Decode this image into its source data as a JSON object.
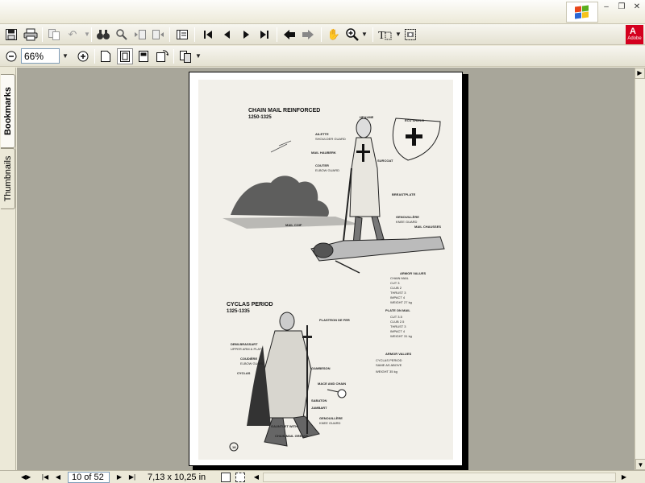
{
  "window": {
    "min_glyph": "–",
    "restore_glyph": "❐",
    "close_glyph": "✕"
  },
  "toolbar": {
    "brand": "Adobe",
    "icons": [
      "save-icon",
      "print-icon",
      "copy-icon",
      "undo-icon",
      "find-icon",
      "search-icon",
      "previous-view-icon",
      "next-view-icon",
      "document-properties-icon",
      "first-page-icon",
      "previous-page-icon",
      "next-page-icon",
      "last-page-icon",
      "go-back-icon",
      "go-forward-icon",
      "hand-tool-icon",
      "zoom-in-icon",
      "text-select-icon",
      "snapshot-icon"
    ]
  },
  "zoombar": {
    "zoom_value": "66%",
    "icons": [
      "zoom-out-icon",
      "zoom-in-circle-icon",
      "actual-size-icon",
      "fit-page-icon",
      "fit-width-icon",
      "rotate-view-icon",
      "page-layout-icon"
    ]
  },
  "side_tabs": {
    "bookmarks": "Bookmarks",
    "thumbnails": "Thumbnails"
  },
  "document": {
    "section1_title": "CHAIN MAIL REINFORCED",
    "section1_years": "1250-1325",
    "section2_title": "CYCLAS PERIOD",
    "section2_years": "1325-1335",
    "labels1": {
      "heaume": "HEAUME",
      "ailette": "AILETTE",
      "shoulder_guard": "SHOULDER GUARD",
      "mail_hauberk": "MAIL HAUBERK",
      "couter": "COUTER",
      "elbow_guard": "ELBOW GUARD",
      "surcoat": "SURCOAT",
      "ecu": "ÉCU SHIELD",
      "breastplate": "BREASTPLATE",
      "mail_coif": "MAIL COIF",
      "genouillere": "GENOUILLÈRE",
      "knee_guard": "KNEE GUARD",
      "mail_chausses": "MAIL CHAUSSES"
    },
    "labels2": {
      "plastron": "PLASTRON DE FER",
      "demi_brassart": "DEMI-BRASSART",
      "upper_arm": "UPPER ARM & PLATE",
      "coudiere": "COUDIÈRE",
      "elbow_guard": "ELBOW GUARD",
      "cyclas": "CYCLAS",
      "gambeson": "GAMBESON",
      "mace": "MACE AND CHAIN",
      "sabaton": "SABATON",
      "jambart": "JAMBART",
      "genouillere": "GENOUILLÈRE",
      "knee_guard": "KNEE GUARD",
      "gauntlet": "GAUNTLET WITH",
      "chain_mail_greave": "CHAIN MAIL GREAVE",
      "page_number": "18"
    },
    "armor_values_1": {
      "title": "ARMOR VALUES",
      "lines": [
        "CHAIN MAIL",
        "CUT 3",
        "CLUB 2",
        "THRUST 3",
        "IMPACT 4",
        "WEIGHT 27 kg"
      ]
    },
    "armor_values_2": {
      "title": "PLATE ON MAIL",
      "lines": [
        "CUT 3.5",
        "CLUB 2.5",
        "THRUST 3",
        "IMPACT 4",
        "WEIGHT 31 kg"
      ]
    },
    "armor_values_3": {
      "title": "ARMOR VALUES",
      "lines": [
        "CYCLAS PERIOD",
        "SAME AS ABOVE",
        "WEIGHT 35 kg"
      ]
    }
  },
  "status": {
    "page_indicator": "10 of 52",
    "page_size": "7,13 x 10,25 in"
  },
  "colors": {
    "chrome": "#ece9d8",
    "doc_background": "#a8a69a",
    "paper": "#f2f0ea",
    "adobe_red": "#d4001e"
  }
}
